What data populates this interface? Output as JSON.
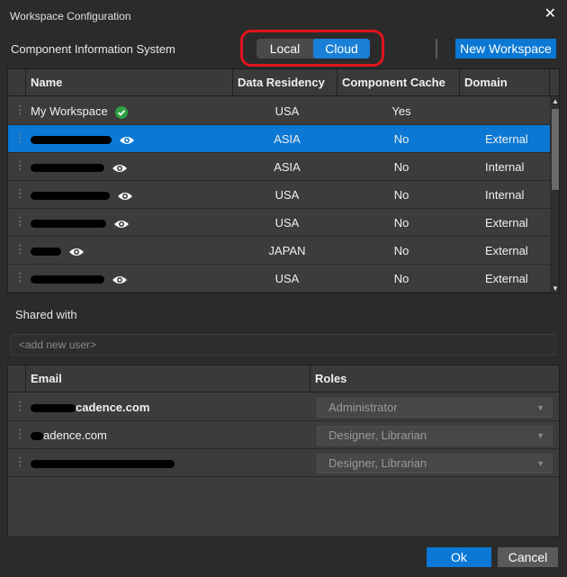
{
  "window": {
    "title": "Workspace Configuration",
    "close_glyph": "✕"
  },
  "header": {
    "label": "Component Information System",
    "toggle": {
      "options": [
        "Local",
        "Cloud"
      ],
      "selected": "Cloud"
    },
    "new_workspace_label": "New Workspace"
  },
  "workspaces": {
    "columns": [
      "Name",
      "Data Residency",
      "Component Cache",
      "Domain"
    ],
    "rows": [
      {
        "name": "My Workspace",
        "name_redacted": false,
        "icon": "check-circle-icon",
        "residency": "USA",
        "cache": "Yes",
        "domain": "",
        "selected": false
      },
      {
        "name": "",
        "name_redacted": true,
        "icon": "eye-icon",
        "residency": "ASIA",
        "cache": "No",
        "domain": "External",
        "selected": true
      },
      {
        "name": "",
        "name_redacted": true,
        "icon": "eye-icon",
        "residency": "ASIA",
        "cache": "No",
        "domain": "Internal",
        "selected": false
      },
      {
        "name": "",
        "name_redacted": true,
        "icon": "eye-icon",
        "residency": "USA",
        "cache": "No",
        "domain": "Internal",
        "selected": false
      },
      {
        "name": "",
        "name_redacted": true,
        "icon": "eye-icon",
        "residency": "USA",
        "cache": "No",
        "domain": "External",
        "selected": false
      },
      {
        "name": "",
        "name_redacted": true,
        "icon": "eye-icon",
        "residency": "JAPAN",
        "cache": "No",
        "domain": "External",
        "selected": false
      },
      {
        "name": "",
        "name_redacted": true,
        "icon": "eye-icon",
        "residency": "USA",
        "cache": "No",
        "domain": "External",
        "selected": false
      }
    ]
  },
  "shared": {
    "label": "Shared with",
    "add_user_placeholder": "<add new user>",
    "columns": [
      "Email",
      "Roles"
    ],
    "rows": [
      {
        "email_suffix": "cadence.com",
        "role": "Administrator"
      },
      {
        "email_suffix": "adence.com",
        "role": "Designer, Librarian"
      },
      {
        "email_suffix": "",
        "role": "Designer, Librarian"
      }
    ]
  },
  "footer": {
    "ok_label": "Ok",
    "cancel_label": "Cancel"
  },
  "colors": {
    "accent": "#0a78d4",
    "highlight_outline": "#e0141b",
    "check_green": "#2ea043"
  }
}
